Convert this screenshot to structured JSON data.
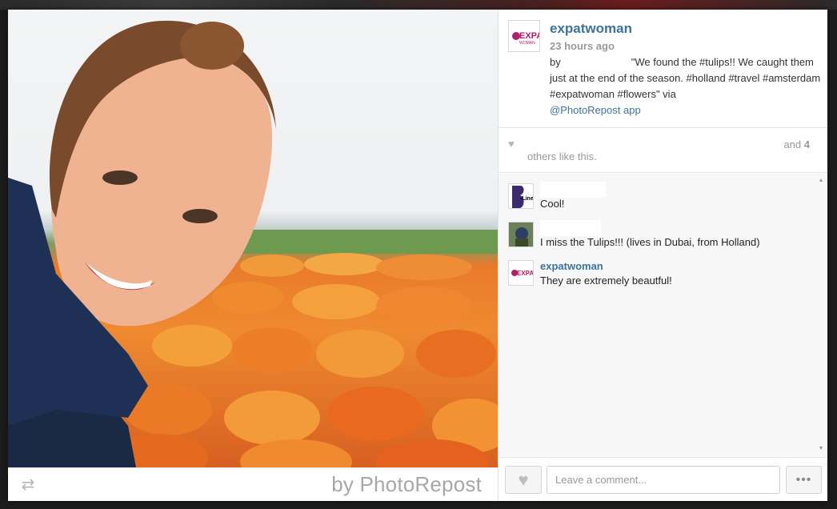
{
  "post": {
    "owner": "expatwoman",
    "time": "23 hours ago",
    "caption_by": "by",
    "caption_text": "\"We found the #tulips!! We caught them just at the end of the season. #holland #travel #amsterdam #expatwoman #flowers\" via",
    "caption_mention": "@PhotoRepost",
    "caption_app": "app",
    "watermark": "by PhotoRepost"
  },
  "likes": {
    "and_prefix": "and",
    "count": "4",
    "tail": "others like this."
  },
  "comments": [
    {
      "user": "",
      "text": "Cool!",
      "avatar": "bline-avatar"
    },
    {
      "user": "",
      "text": "I miss the Tulips!!! (lives in Dubai, from Holland)",
      "avatar": "photo-avatar"
    },
    {
      "user": "expatwoman",
      "text": "They are extremely beautful!",
      "avatar": "expat-avatar"
    }
  ],
  "actions": {
    "comment_placeholder": "Leave a comment...",
    "more_label": "•••"
  },
  "icons": {
    "like": "heart-icon",
    "repost": "repost-icon",
    "more": "ellipsis-icon"
  },
  "colors": {
    "link": "#3f729b",
    "muted": "#999999"
  }
}
